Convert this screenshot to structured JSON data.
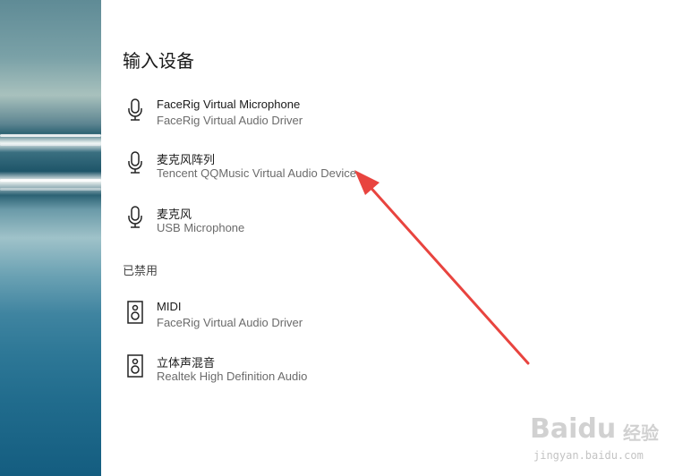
{
  "heading": "输入设备",
  "disabled_label": "已禁用",
  "input_devices": [
    {
      "name": "FaceRig Virtual Microphone",
      "driver": "FaceRig Virtual Audio Driver",
      "icon": "microphone-icon"
    },
    {
      "name": "麦克风阵列",
      "driver": "Tencent QQMusic Virtual Audio Device",
      "icon": "microphone-icon"
    },
    {
      "name": "麦克风",
      "driver": "USB Microphone",
      "icon": "microphone-icon"
    }
  ],
  "disabled_devices": [
    {
      "name": "MIDI",
      "driver": "FaceRig Virtual Audio Driver",
      "icon": "speaker-icon"
    },
    {
      "name": "立体声混音",
      "driver": "Realtek High Definition Audio",
      "icon": "speaker-icon"
    }
  ],
  "watermark": {
    "logo": "Baidu",
    "jingyan": "经验",
    "url": "jingyan.baidu.com"
  },
  "colors": {
    "arrow": "#e8443f",
    "text_primary": "#1a1a1a",
    "text_secondary": "#6b6b6b"
  }
}
